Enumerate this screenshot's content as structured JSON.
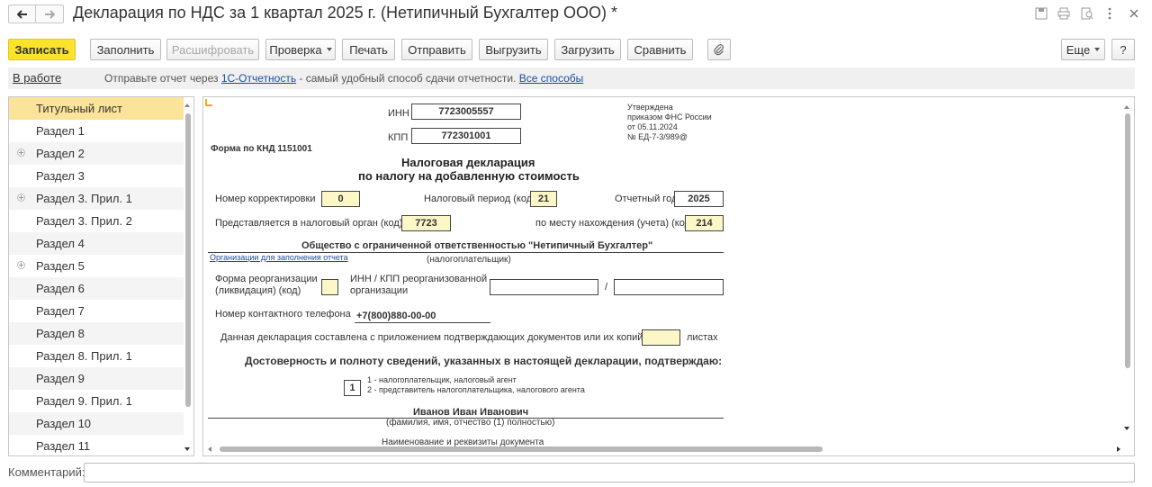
{
  "window": {
    "title": "Декларация по НДС за 1 квартал 2025 г. (Нетипичный Бухгалтер ООО) *"
  },
  "toolbar": {
    "save_label": "Записать",
    "fill_label": "Заполнить",
    "decode_label": "Расшифровать",
    "check_label": "Проверка",
    "print_label": "Печать",
    "send_label": "Отправить",
    "export_label": "Выгрузить",
    "import_label": "Загрузить",
    "compare_label": "Сравнить",
    "more_label": "Еще",
    "help_label": "?"
  },
  "infobar": {
    "status": "В работе",
    "text_before": "Отправьте отчет через ",
    "link_1c": "1С-Отчетность",
    "text_middle": " - самый удобный способ сдачи отчетности. ",
    "link_all": "Все способы"
  },
  "sidebar": {
    "items": [
      {
        "label": "Титульный лист"
      },
      {
        "label": "Раздел 1"
      },
      {
        "label": "Раздел 2"
      },
      {
        "label": "Раздел 3"
      },
      {
        "label": "Раздел 3. Прил. 1"
      },
      {
        "label": "Раздел 3. Прил. 2"
      },
      {
        "label": "Раздел 4"
      },
      {
        "label": "Раздел 5"
      },
      {
        "label": "Раздел 6"
      },
      {
        "label": "Раздел 7"
      },
      {
        "label": "Раздел 8"
      },
      {
        "label": "Раздел 8. Прил. 1"
      },
      {
        "label": "Раздел 9"
      },
      {
        "label": "Раздел 9. Прил. 1"
      },
      {
        "label": "Раздел 10"
      },
      {
        "label": "Раздел 11"
      }
    ]
  },
  "form": {
    "inn_label": "ИНН",
    "inn_value": "7723005557",
    "kpp_label": "КПП",
    "kpp_value": "772301001",
    "approved_line1": "Утверждена",
    "approved_line2": "приказом ФНС России",
    "approved_line3": "от 05.11.2024",
    "approved_line4": "№ ЕД-7-3/989@",
    "knd": "Форма по КНД 1151001",
    "heading_line1": "Налоговая декларация",
    "heading_line2": "по налогу на добавленную стоимость",
    "correction_label": "Номер корректировки",
    "correction_value": "0",
    "period_label": "Налоговый период (код)",
    "period_value": "21",
    "year_label": "Отчетный год",
    "year_value": "2025",
    "authority_label": "Представляется в налоговый орган (код)",
    "authority_value": "7723",
    "location_label": "по месту нахождения (учета) (код)",
    "location_value": "214",
    "org_name": "Общество с ограниченной ответственностью \"Нетипичный Бухгалтер\"",
    "org_link": "Организации для заполнения отчета",
    "taxpayer_caption": "(налогоплательщик)",
    "reorg_label_1": "Форма реорганизации",
    "reorg_label_2": "(ликвидация) (код)",
    "reorg_inn_label_1": "ИНН / КПП реорганизованной",
    "reorg_inn_label_2": "организации",
    "slash": "/",
    "phone_label": "Номер контактного телефона",
    "phone_value": "+7(800)880-00-00",
    "attach_label": "Данная декларация составлена с приложением подтверждающих документов или их копий на",
    "attach_suffix": "листах",
    "confirm_heading": "Достоверность и полноту сведений, указанных в настоящей декларации, подтверждаю:",
    "signer_code": "1",
    "signer_opt1": "1 - налогоплательщик, налоговый агент",
    "signer_opt2": "2 - представитель налогоплательщика, налогового агента",
    "signer_name": "Иванов Иван Иванович",
    "signer_caption": "(фамилия, имя, отчество (1)  полностью)",
    "doc_caption": "Наименование и реквизиты документа"
  },
  "comment": {
    "label": "Комментарий:",
    "value": ""
  },
  "colors": {
    "accent": "#fbe32b",
    "selection": "#fbe39a",
    "field_fill": "#fdf6c7",
    "link": "#1a4da2"
  }
}
